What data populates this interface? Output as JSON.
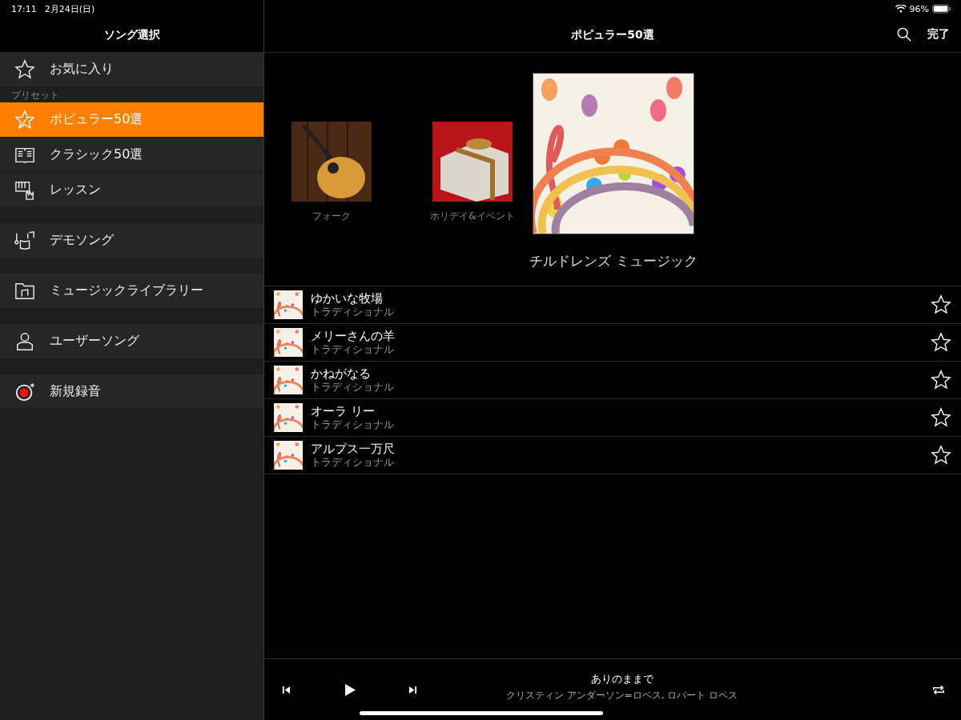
{
  "status_bar": {
    "time": "17:11",
    "date": "2月24日(日)",
    "battery": "96%"
  },
  "sidebar": {
    "title": "ソング選択",
    "groups": [
      {
        "items": [
          {
            "label": "お気に入り",
            "selected": false
          }
        ]
      },
      {
        "label": "プリセット",
        "items": [
          {
            "label": "ポピュラー50選",
            "selected": true
          },
          {
            "label": "クラシック50選",
            "selected": false
          },
          {
            "label": "レッスン",
            "selected": false
          }
        ]
      },
      {
        "items": [
          {
            "label": "デモソング",
            "selected": false
          }
        ]
      },
      {
        "items": [
          {
            "label": "ミュージックライブラリー",
            "selected": false
          }
        ]
      },
      {
        "items": [
          {
            "label": "ユーザーソング",
            "selected": false
          }
        ]
      },
      {
        "items": [
          {
            "label": "新規録音",
            "selected": false
          }
        ]
      }
    ]
  },
  "header": {
    "title": "ポピュラー50選",
    "done": "完了"
  },
  "albums": [
    {
      "title": "フォーク",
      "kind": "guitar",
      "selected": false
    },
    {
      "title": "ホリデイ&イベント",
      "kind": "gift",
      "selected": false
    },
    {
      "title": "チルドレンズ ミュージック",
      "kind": "kids",
      "selected": true
    }
  ],
  "songs": [
    {
      "title": "ゆかいな牧場",
      "artist": "トラディショナル",
      "favorite": false
    },
    {
      "title": "メリーさんの羊",
      "artist": "トラディショナル",
      "favorite": false
    },
    {
      "title": "かねがなる",
      "artist": "トラディショナル",
      "favorite": false
    },
    {
      "title": "オーラ リー",
      "artist": "トラディショナル",
      "favorite": false
    },
    {
      "title": "アルプス一万尺",
      "artist": "トラディショナル",
      "favorite": false
    }
  ],
  "player": {
    "title": "ありのままで",
    "artist": "クリスティン アンダーソン=ロペス, ロバート ロペス"
  }
}
